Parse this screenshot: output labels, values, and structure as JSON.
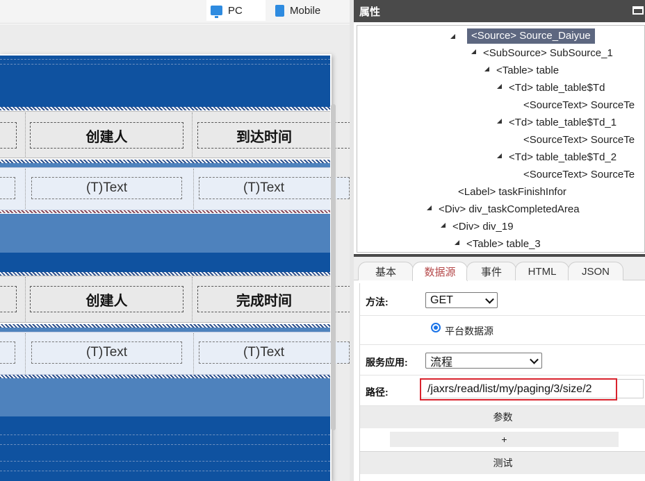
{
  "devices": {
    "pc": "PC",
    "mobile": "Mobile"
  },
  "canvas": {
    "table1": {
      "col2": "创建人",
      "col3": "到达时间",
      "cell": "(T)Text"
    },
    "table2": {
      "col2": "创建人",
      "col3": "完成时间",
      "cell": "(T)Text"
    }
  },
  "panel": {
    "title": "属性"
  },
  "tree": [
    {
      "text": "<Source> Source_Daiyue",
      "selected": true
    },
    {
      "text": "<SubSource> SubSource_1"
    },
    {
      "text": "<Table> table"
    },
    {
      "text": "<Td> table_table$Td"
    },
    {
      "text": "<SourceText> SourceTe"
    },
    {
      "text": "<Td> table_table$Td_1"
    },
    {
      "text": "<SourceText> SourceTe"
    },
    {
      "text": "<Td> table_table$Td_2"
    },
    {
      "text": "<SourceText> SourceTe"
    },
    {
      "text": "<Label> taskFinishInfor"
    },
    {
      "text": "<Div> div_taskCompletedArea"
    },
    {
      "text": "<Div> div_19"
    },
    {
      "text": "<Table> table_3"
    }
  ],
  "tabs": [
    "基本",
    "数据源",
    "事件",
    "HTML",
    "JSON"
  ],
  "active_tab": "数据源",
  "form": {
    "method_label": "方法:",
    "method_value": "GET",
    "radio_label": "平台数据源",
    "service_label": "服务应用:",
    "service_value": "流程",
    "path_label": "路径:",
    "path_value": "/jaxrs/read/list/my/paging/3/size/2",
    "params_label": "参数",
    "add_label": "+",
    "test_label": "测试"
  },
  "colors": {
    "highlight": "#d9232d",
    "canvas_dark": "#0f52a0",
    "canvas_light": "#4e82bd"
  }
}
